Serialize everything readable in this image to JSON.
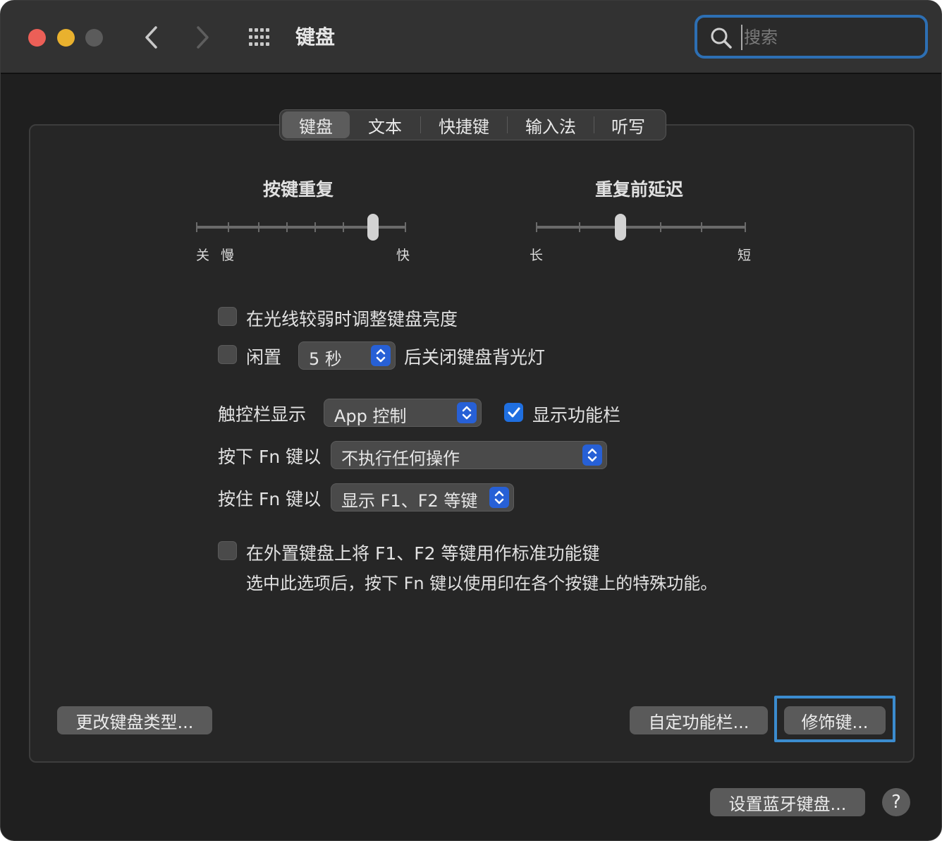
{
  "window": {
    "title": "键盘"
  },
  "search": {
    "placeholder": "搜索",
    "value": ""
  },
  "tabs": [
    {
      "label": "键盘",
      "active": true
    },
    {
      "label": "文本",
      "active": false
    },
    {
      "label": "快捷键",
      "active": false
    },
    {
      "label": "输入法",
      "active": false
    },
    {
      "label": "听写",
      "active": false
    }
  ],
  "key_repeat": {
    "title": "按键重复",
    "label_off": "关",
    "label_slow": "慢",
    "label_fast": "快",
    "level": 0.85
  },
  "repeat_delay": {
    "title": "重复前延迟",
    "label_long": "长",
    "label_short": "短",
    "level": 0.4
  },
  "options": {
    "adjust_brightness": {
      "label": "在光线较弱时调整键盘亮度",
      "checked": false
    },
    "idle": {
      "label": "闲置",
      "checked": false,
      "popup_value": "5 秒",
      "suffix": "后关闭键盘背光灯"
    },
    "touch_bar": {
      "label": "触控栏显示",
      "popup_value": "App 控制",
      "show_control_strip_label": "显示功能栏",
      "show_control_strip_checked": true
    },
    "press_fn": {
      "label": "按下 Fn 键以",
      "popup_value": "不执行任何操作"
    },
    "hold_fn": {
      "label": "按住 Fn 键以",
      "popup_value": "显示 F1、F2 等键"
    },
    "standard_fn": {
      "label": "在外置键盘上将 F1、F2 等键用作标准功能键",
      "description": "选中此选项后，按下 Fn 键以使用印在各个按键上的特殊功能。",
      "checked": false
    }
  },
  "buttons": {
    "change_keyboard_type": "更改键盘类型...",
    "customize_control_strip": "自定功能栏...",
    "modifier_keys": "修饰键...",
    "setup_bluetooth_keyboard": "设置蓝牙键盘...",
    "help": "?"
  },
  "colors": {
    "accent": "#2760d6",
    "focus_ring": "#3b8ccf",
    "close": "#ec5f57",
    "minimize": "#e9b12e"
  }
}
